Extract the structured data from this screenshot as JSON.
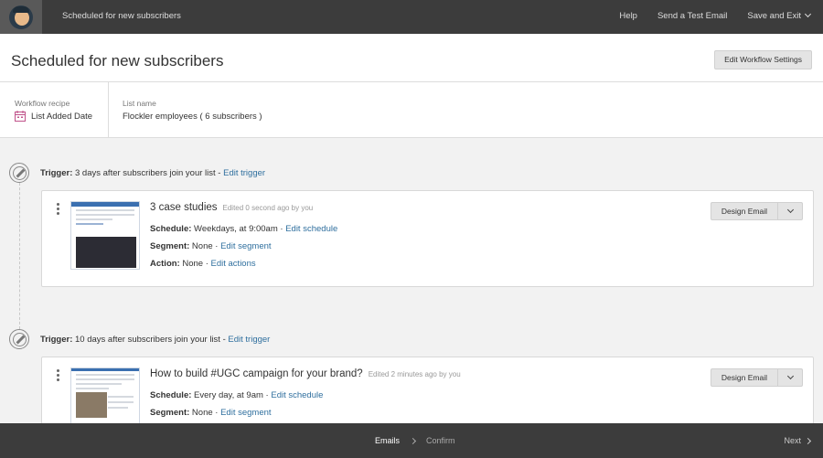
{
  "topbar": {
    "title": "Scheduled for new subscribers",
    "help": "Help",
    "test_email": "Send a Test Email",
    "save_exit": "Save and Exit"
  },
  "header": {
    "title": "Scheduled for new subscribers",
    "settings_button": "Edit Workflow Settings"
  },
  "info": {
    "recipe_label": "Workflow recipe",
    "recipe_value": "List Added Date",
    "list_label": "List name",
    "list_value": "Flockler employees ( 6 subscribers )"
  },
  "workflow": [
    {
      "trigger_label": "Trigger:",
      "trigger_text": " 3 days after subscribers join your list - ",
      "trigger_link": "Edit trigger",
      "title": "3 case studies",
      "edited": "Edited 0 second ago by you",
      "schedule_label": "Schedule:",
      "schedule_value": " Weekdays, at 9:00am · ",
      "schedule_link": "Edit schedule",
      "segment_label": "Segment:",
      "segment_value": " None · ",
      "segment_link": "Edit segment",
      "action_label": "Action:",
      "action_value": " None · ",
      "action_link": "Edit actions",
      "design_button": "Design Email"
    },
    {
      "trigger_label": "Trigger:",
      "trigger_text": " 10 days after subscribers join your list - ",
      "trigger_link": "Edit trigger",
      "title": "How to build #UGC campaign for your brand?",
      "edited": "Edited 2 minutes ago by you",
      "schedule_label": "Schedule:",
      "schedule_value": " Every day, at 9am · ",
      "schedule_link": "Edit schedule",
      "segment_label": "Segment:",
      "segment_value": " None · ",
      "segment_link": "Edit segment",
      "design_button": "Design Email"
    }
  ],
  "footer": {
    "step_emails": "Emails",
    "step_confirm": "Confirm",
    "next": "Next"
  },
  "colors": {
    "topbar": "#3c3c3c",
    "link": "#2f6f9e",
    "page_bg": "#f2f2f2"
  }
}
